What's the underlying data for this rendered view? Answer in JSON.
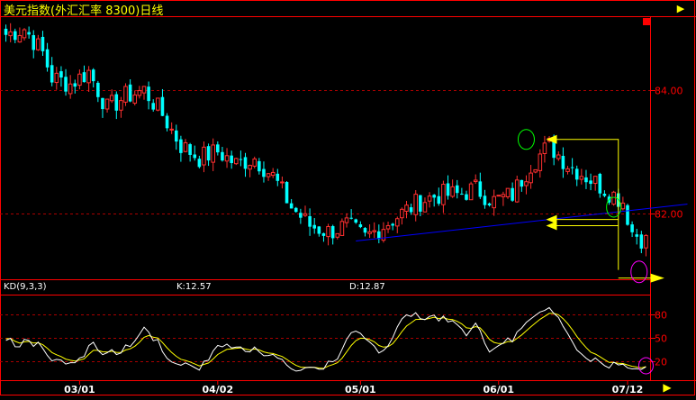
{
  "title": "美元指数(外汇汇率 8300)日线",
  "indicator": {
    "name": "KD(9,3,3)",
    "k_label": "K:12.57",
    "d_label": "D:12.87"
  },
  "colors": {
    "background": "#000000",
    "frame": "#ff0000",
    "grid": "#aa0000",
    "axis_text": "#ff0000",
    "up_candle": "#ff3030",
    "down_candle": "#00ffff",
    "trendline": "#0000ff",
    "annotation_arrow": "#ffff00",
    "k_line": "#ffffff",
    "d_line": "#ffff00",
    "highlight_circle_green": "#00ff00",
    "highlight_circle_magenta": "#ff00ff"
  },
  "icons": {
    "scroll_right": "triangle-right-icon",
    "panel_marker": "red-square-icon"
  },
  "chart_data": [
    {
      "type": "candlestick",
      "title": "美元指数(外汇汇率 8300)日线",
      "y_ticks": [
        "84.00",
        "82.00"
      ],
      "y_tick_values": [
        84.0,
        82.0
      ],
      "ylim": [
        80.9,
        85.2
      ],
      "x_ticks": [
        "03/01",
        "04/02",
        "05/01",
        "06/01",
        "07/12"
      ],
      "x_tick_index": [
        16,
        46,
        77,
        107,
        135
      ],
      "count": 140,
      "anchors": [
        [
          0,
          84.9
        ],
        [
          4,
          85.0
        ],
        [
          8,
          84.6
        ],
        [
          10,
          84.2
        ],
        [
          14,
          84.1
        ],
        [
          18,
          84.3
        ],
        [
          22,
          83.7
        ],
        [
          26,
          83.9
        ],
        [
          30,
          84.0
        ],
        [
          34,
          83.6
        ],
        [
          38,
          83.1
        ],
        [
          42,
          82.9
        ],
        [
          46,
          83.0
        ],
        [
          50,
          82.8
        ],
        [
          54,
          82.9
        ],
        [
          58,
          82.6
        ],
        [
          62,
          82.1
        ],
        [
          66,
          81.8
        ],
        [
          70,
          81.7
        ],
        [
          74,
          81.8
        ],
        [
          78,
          81.6
        ],
        [
          82,
          81.8
        ],
        [
          86,
          82.0
        ],
        [
          90,
          82.2
        ],
        [
          94,
          82.3
        ],
        [
          98,
          82.3
        ],
        [
          102,
          82.4
        ],
        [
          106,
          82.2
        ],
        [
          110,
          82.3
        ],
        [
          114,
          82.8
        ],
        [
          118,
          83.1
        ],
        [
          122,
          82.8
        ],
        [
          126,
          82.6
        ],
        [
          130,
          82.4
        ],
        [
          134,
          82.2
        ],
        [
          136,
          81.7
        ],
        [
          140,
          81.5
        ],
        [
          144,
          81.6
        ],
        [
          146,
          81.2
        ],
        [
          148,
          81.0
        ]
      ],
      "trendline": {
        "from": [
          76,
          81.55
        ],
        "to": [
          148,
          82.15
        ]
      }
    },
    {
      "type": "line",
      "indicator": "KD(9,3,3)",
      "y_ticks": [
        "80",
        "50",
        "20"
      ],
      "y_tick_values": [
        80,
        50,
        20
      ],
      "ylim": [
        0,
        100
      ],
      "series": [
        {
          "name": "K",
          "last": 12.57
        },
        {
          "name": "D",
          "last": 12.87
        }
      ]
    }
  ]
}
